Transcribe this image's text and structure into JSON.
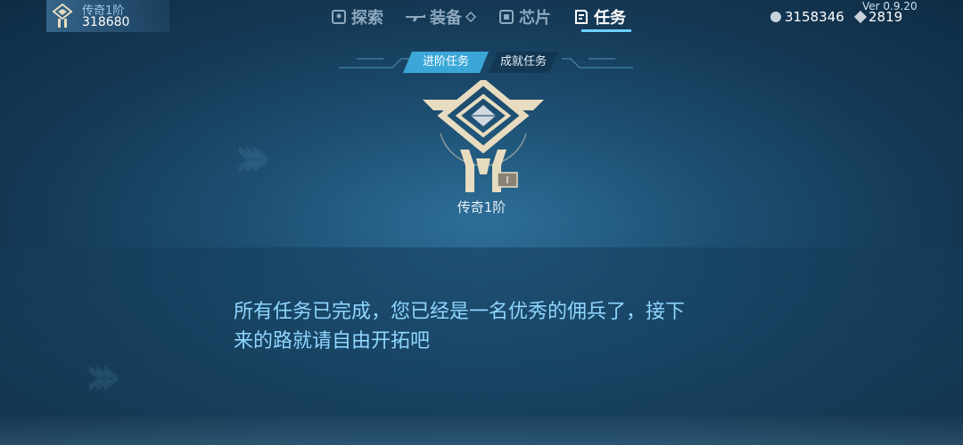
{
  "player": {
    "rank": "传奇1阶",
    "score": "318680"
  },
  "nav": [
    {
      "label": "探索",
      "icon": "map-icon",
      "active": false
    },
    {
      "label": "装备",
      "icon": "rifle-icon",
      "active": false
    },
    {
      "label": "芯片",
      "icon": "chip-icon",
      "active": false
    },
    {
      "label": "任务",
      "icon": "task-icon",
      "active": true
    }
  ],
  "currency": {
    "coins": "3158346",
    "gems": "2819"
  },
  "version": "Ver 0.9.20",
  "tabs": [
    {
      "label": "进阶任务",
      "active": true
    },
    {
      "label": "成就任务",
      "active": false
    }
  ],
  "rank_badge": {
    "title": "传奇1阶",
    "tier": "I"
  },
  "message": {
    "line1": "所有任务已完成，您已经是一名优秀的佣兵了，接下",
    "line2": "来的路就请自由开拓吧"
  },
  "colors": {
    "accent": "#3aa7d8",
    "message": "#8fd6ff",
    "emblem": "#e8dcc0"
  }
}
